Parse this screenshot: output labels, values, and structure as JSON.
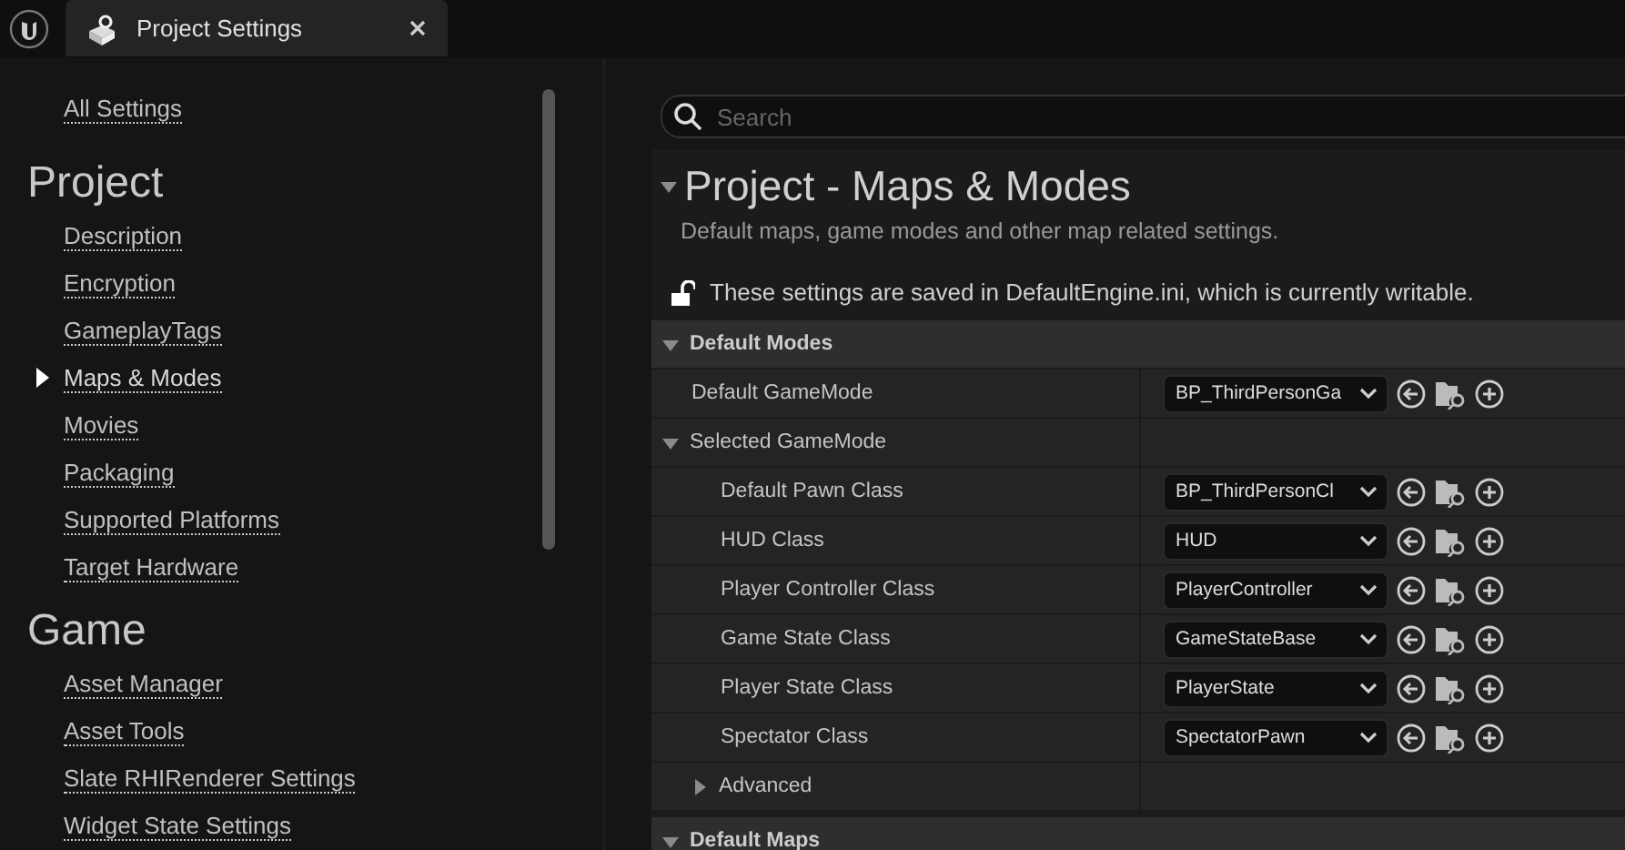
{
  "tab": {
    "title": "Project Settings"
  },
  "sidebar": {
    "top_link": "All Settings",
    "sections": [
      {
        "heading": "Project",
        "items": [
          {
            "label": "Description",
            "selected": false
          },
          {
            "label": "Encryption",
            "selected": false
          },
          {
            "label": "GameplayTags",
            "selected": false
          },
          {
            "label": "Maps & Modes",
            "selected": true
          },
          {
            "label": "Movies",
            "selected": false
          },
          {
            "label": "Packaging",
            "selected": false
          },
          {
            "label": "Supported Platforms",
            "selected": false
          },
          {
            "label": "Target Hardware",
            "selected": false
          }
        ]
      },
      {
        "heading": "Game",
        "items": [
          {
            "label": "Asset Manager",
            "selected": false
          },
          {
            "label": "Asset Tools",
            "selected": false
          },
          {
            "label": "Slate RHIRenderer Settings",
            "selected": false
          },
          {
            "label": "Widget State Settings",
            "selected": false
          }
        ]
      }
    ]
  },
  "search": {
    "placeholder": "Search"
  },
  "page": {
    "title": "Project - Maps & Modes",
    "description": "Default maps, game modes and other map related settings.",
    "config_note": "These settings are saved in DefaultEngine.ini, which is currently writable.",
    "locked": false
  },
  "categories": [
    {
      "title": "Default Modes",
      "expanded": true,
      "items": [
        {
          "kind": "property",
          "label": "Default GameMode",
          "value": "BP_ThirdPersonGa"
        },
        {
          "kind": "group",
          "label": "Selected GameMode",
          "expanded": true,
          "children": [
            {
              "kind": "property",
              "label": "Default Pawn Class",
              "value": "BP_ThirdPersonCl"
            },
            {
              "kind": "property",
              "label": "HUD Class",
              "value": "HUD"
            },
            {
              "kind": "property",
              "label": "Player Controller Class",
              "value": "PlayerController"
            },
            {
              "kind": "property",
              "label": "Game State Class",
              "value": "GameStateBase"
            },
            {
              "kind": "property",
              "label": "Player State Class",
              "value": "PlayerState"
            },
            {
              "kind": "property",
              "label": "Spectator Class",
              "value": "SpectatorPawn"
            },
            {
              "kind": "group",
              "label": "Advanced",
              "expanded": false
            }
          ]
        }
      ]
    },
    {
      "title": "Default Maps",
      "expanded": true
    }
  ]
}
